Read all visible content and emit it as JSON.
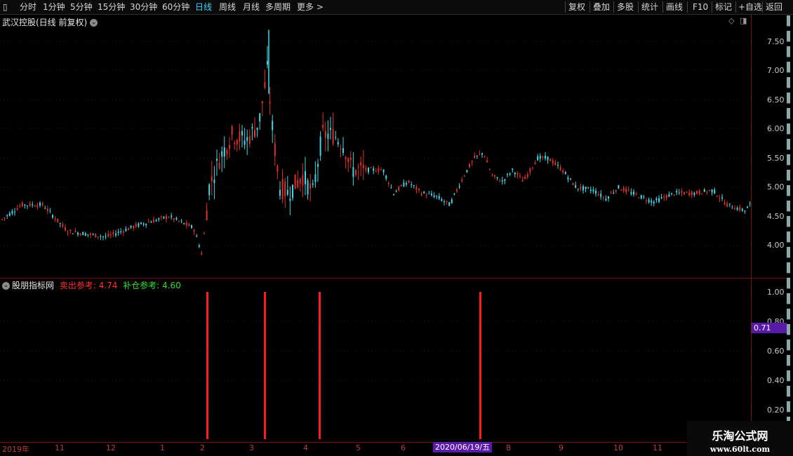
{
  "toolbar": {
    "left_items": [
      "分时",
      "1分钟",
      "5分钟",
      "15分钟",
      "30分钟",
      "60分钟",
      "日线",
      "周线",
      "月线",
      "多周期",
      "更多 >"
    ],
    "active_item": "日线",
    "right_items": [
      "复权",
      "叠加",
      "多股",
      "统计",
      "画线",
      "F10",
      "标记",
      "+自选",
      "返回"
    ]
  },
  "main_panel": {
    "title": "武汉控股(日线 前复权)",
    "price_labels": [
      "7.50",
      "7.00",
      "6.50",
      "6.00",
      "5.50",
      "5.00",
      "4.50",
      "4.00"
    ]
  },
  "indicator_panel": {
    "title": "股朋指标网",
    "sell_ref": "卖出参考: 4.74",
    "buy_ref": "补仓参考: 4.60",
    "y_labels": [
      "1.00",
      "0.80",
      "0.60",
      "0.40",
      "0.20"
    ],
    "current_value_badge": "0.71",
    "signal_bars": [
      1,
      1,
      1,
      1
    ]
  },
  "x_axis": {
    "labels": [
      "2019年",
      "11",
      "12",
      "1",
      "2",
      "3",
      "4",
      "5",
      "6",
      "8",
      "9",
      "10",
      "11"
    ],
    "cursor_date": "2020/06/19/五"
  },
  "watermark": {
    "line1": "乐淘公式网",
    "line2": "www.60lt.com"
  },
  "colors": {
    "up": "#e0302a",
    "down": "#3fd8e8",
    "axis": "#7a1212",
    "signal": "#ff1a1a",
    "sell_text": "#ff3030",
    "buy_text": "#33dd33"
  }
}
